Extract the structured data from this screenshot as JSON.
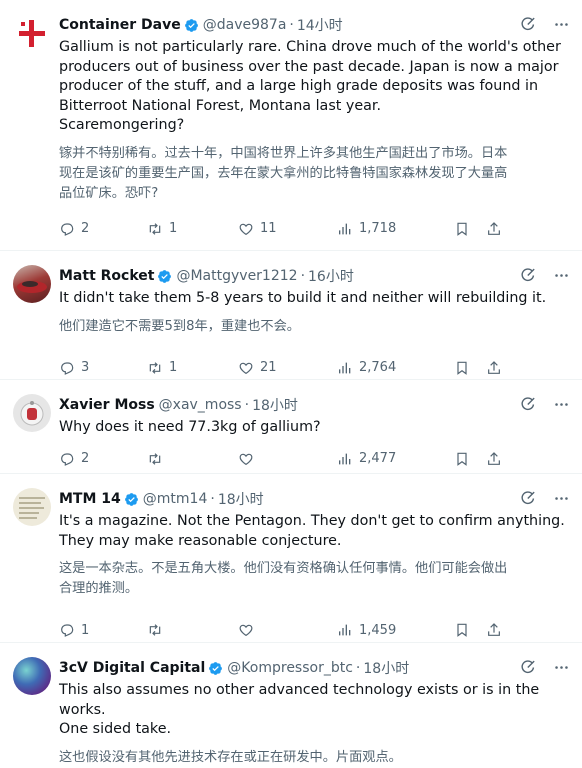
{
  "tweets": [
    {
      "name": "Container Dave",
      "handle": "@dave987a",
      "time": "14小时",
      "text_en": "Gallium is not particularly rare. China drove much of the world's other\nproducers out of business over the past decade. Japan is now a major\nproducer of the stuff, and a large high grade deposits was found in\nBitterroot National Forest, Montana last year.\nScaremongering?",
      "text_zh": "镓并不特别稀有。过去十年，中国将世界上许多其他生产国赶出了市场。日本\n现在是该矿的重要生产国，去年在蒙大拿州的比特鲁特国家森林发现了大量高\n品位矿床。恐吓?",
      "replies": "2",
      "retweets": "1",
      "likes": "11",
      "views": "1,718"
    },
    {
      "name": "Matt Rocket",
      "handle": "@Mattgyver1212",
      "time": "16小时",
      "text_en": "It didn't take them 5-8 years to build it and neither will rebuilding it.",
      "text_zh": "他们建造它不需要5到8年，重建也不会。",
      "replies": "3",
      "retweets": "1",
      "likes": "21",
      "views": "2,764"
    },
    {
      "name": "Xavier Moss",
      "handle": "@xav_moss",
      "time": "18小时",
      "text_en": "Why does it need 77.3kg of gallium?",
      "text_zh": "",
      "replies": "2",
      "retweets": "",
      "likes": "",
      "views": "2,477"
    },
    {
      "name": "MTM 14",
      "handle": "@mtm14",
      "time": "18小时",
      "text_en": "It's a magazine.  Not the Pentagon.  They don't get to confirm anything.\nThey may make reasonable conjecture.",
      "text_zh": "这是一本杂志。不是五角大楼。他们没有资格确认任何事情。他们可能会做出\n合理的推测。",
      "replies": "1",
      "retweets": "",
      "likes": "",
      "views": "1,459"
    },
    {
      "name": "3cV Digital Capital",
      "handle": "@Kompressor_btc",
      "time": "18小时",
      "text_en": "This also assumes no other advanced technology exists or is in the works.\nOne sided take.",
      "text_zh": "这也假设没有其他先进技术存在或正在研发中。片面观点。",
      "replies": "",
      "retweets": "",
      "likes": "",
      "views": ""
    }
  ],
  "icons": {
    "translate": "grok-translate-icon",
    "more": "more-icon",
    "reply": "reply-icon",
    "retweet": "retweet-icon",
    "like": "like-icon",
    "views": "views-icon",
    "bookmark": "bookmark-icon",
    "share": "share-icon",
    "verified": "verified-badge-icon"
  },
  "colors": {
    "verified": "#1d9bf0",
    "secondary_text": "#536471",
    "primary_text": "#0f1419",
    "divider": "#eff3f4"
  }
}
